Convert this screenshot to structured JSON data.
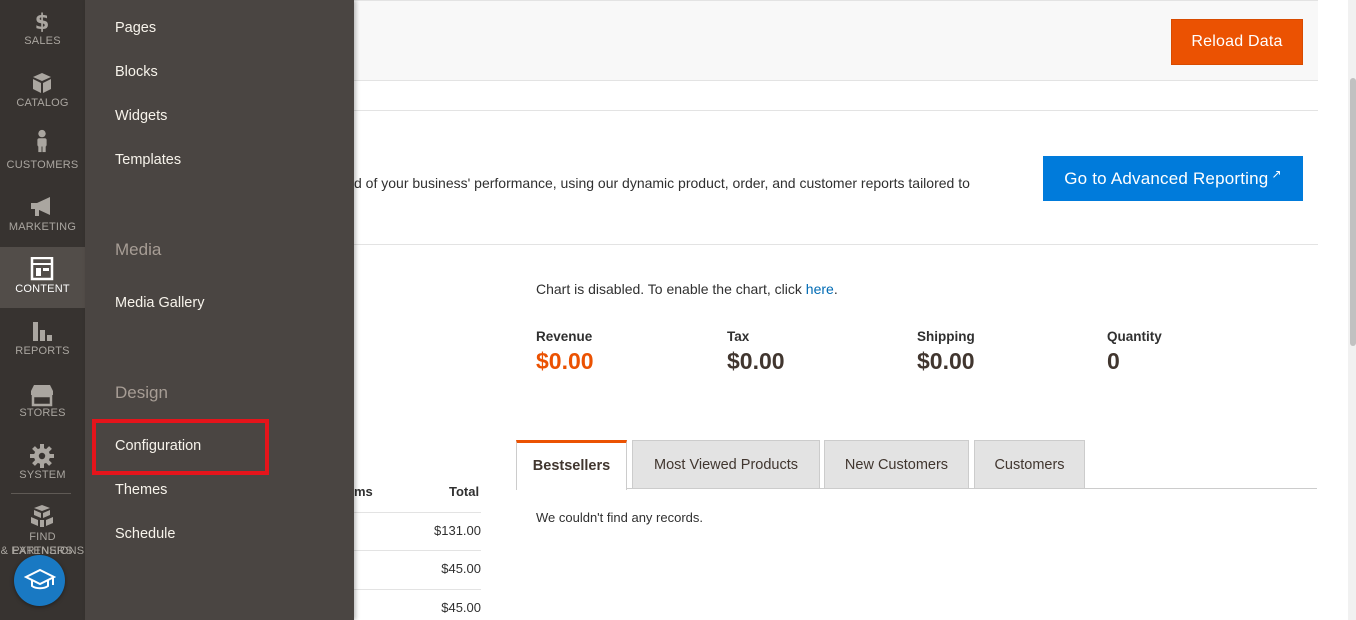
{
  "admin_nav": {
    "items": [
      {
        "label": "SALES",
        "icon": "dollar-icon"
      },
      {
        "label": "CATALOG",
        "icon": "cube-icon"
      },
      {
        "label": "CUSTOMERS",
        "icon": "person-icon"
      },
      {
        "label": "MARKETING",
        "icon": "megaphone-icon"
      },
      {
        "label": "CONTENT",
        "icon": "layout-icon",
        "active": true
      },
      {
        "label": "REPORTS",
        "icon": "bar-chart-icon"
      },
      {
        "label": "STORES",
        "icon": "store-icon"
      },
      {
        "label": "SYSTEM",
        "icon": "gear-icon"
      },
      {
        "label_line1": "FIND PARTNERS",
        "label_line2": "& EXTENSIONS",
        "icon": "boxes-icon"
      }
    ],
    "help_icon": "graduation-cap-icon"
  },
  "content_submenu": {
    "elements": [
      "Pages",
      "Blocks",
      "Widgets",
      "Templates"
    ],
    "media_title": "Media",
    "media": [
      "Media Gallery"
    ],
    "design_title": "Design",
    "design": [
      "Configuration",
      "Themes",
      "Schedule"
    ],
    "highlighted": "Configuration"
  },
  "header": {
    "reload_button": "Reload Data"
  },
  "advanced_reporting": {
    "text": "d of your business' performance, using our dynamic product, order, and customer reports tailored to",
    "button": "Go to Advanced Reporting",
    "button_icon": "external-link-icon"
  },
  "chart": {
    "message": "Chart is disabled. To enable the chart, click ",
    "link": "here",
    "period": "."
  },
  "totals": [
    {
      "label": "Revenue",
      "value": "$0.00"
    },
    {
      "label": "Tax",
      "value": "$0.00"
    },
    {
      "label": "Shipping",
      "value": "$0.00"
    },
    {
      "label": "Quantity",
      "value": "0"
    }
  ],
  "orders_table": {
    "col_items": "ms",
    "col_total": "Total",
    "rows": [
      "$131.00",
      "$45.00",
      "$45.00"
    ]
  },
  "tabs": [
    "Bestsellers",
    "Most Viewed Products",
    "New Customers",
    "Customers"
  ],
  "tab_content": "We couldn't find any records.",
  "colors": {
    "accent_orange": "#eb5202",
    "link_blue": "#006bb4",
    "button_blue": "#007bdb",
    "nav_bg": "#373330",
    "submenu_bg": "#4a4542",
    "highlight_red": "#e5141b"
  }
}
